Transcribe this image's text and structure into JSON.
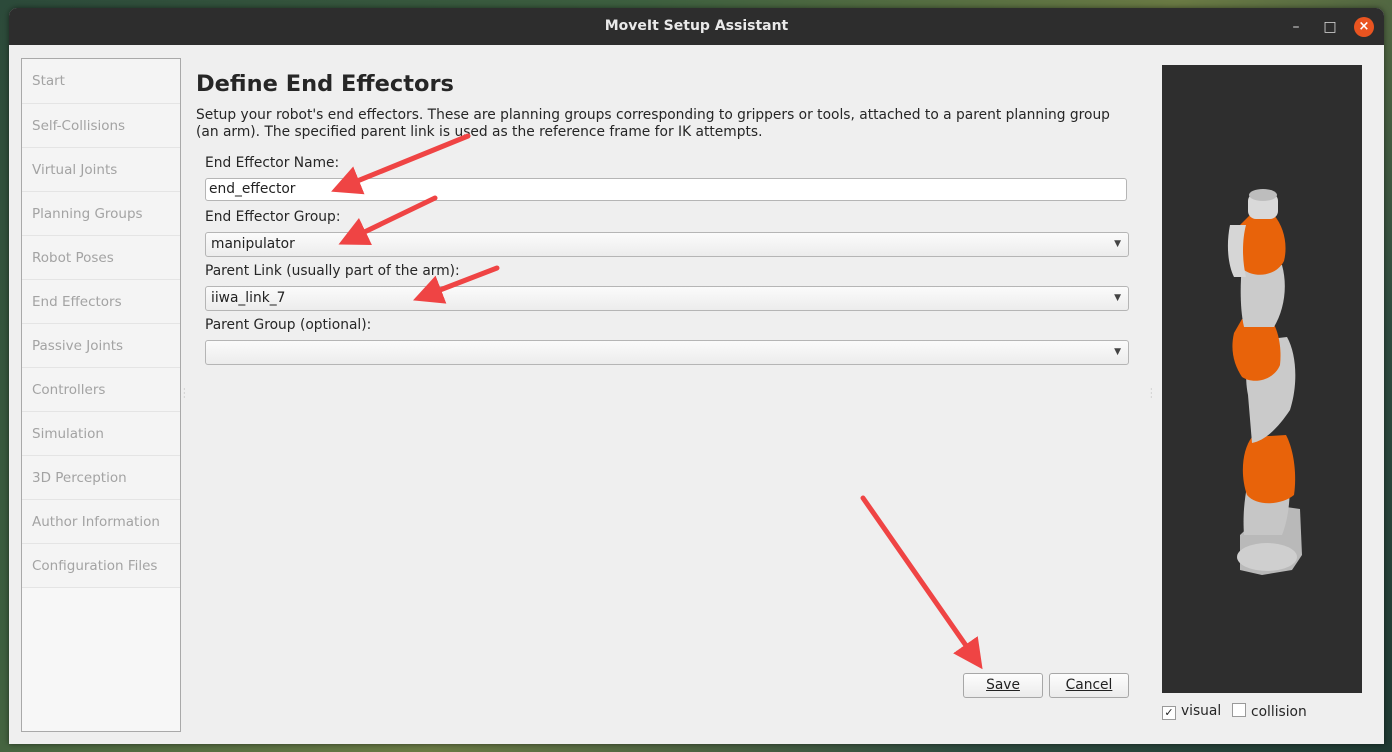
{
  "window": {
    "title": "MoveIt Setup Assistant"
  },
  "window_controls": {
    "minimize": "–",
    "maximize": "□",
    "close": "×"
  },
  "sidebar": {
    "items": [
      {
        "label": "Start"
      },
      {
        "label": "Self-Collisions"
      },
      {
        "label": "Virtual Joints"
      },
      {
        "label": "Planning Groups"
      },
      {
        "label": "Robot Poses"
      },
      {
        "label": "End Effectors"
      },
      {
        "label": "Passive Joints"
      },
      {
        "label": "Controllers"
      },
      {
        "label": "Simulation"
      },
      {
        "label": "3D Perception"
      },
      {
        "label": "Author Information"
      },
      {
        "label": "Configuration Files"
      }
    ]
  },
  "main": {
    "title": "Define End Effectors",
    "description": "Setup your robot's end effectors. These are planning groups corresponding to grippers or tools, attached to a parent planning group (an arm). The specified parent link is used as the reference frame for IK attempts.",
    "ee_name": {
      "label": "End Effector Name:",
      "value": "end_effector"
    },
    "ee_group": {
      "label": "End Effector Group:",
      "value": "manipulator"
    },
    "parent_link": {
      "label": "Parent Link (usually part of the arm):",
      "value": "iiwa_link_7"
    },
    "parent_group": {
      "label": "Parent Group (optional):",
      "value": ""
    },
    "save_label": "Save",
    "cancel_label": "Cancel"
  },
  "viewer": {
    "visual_label": "visual",
    "visual_checked": true,
    "collision_label": "collision",
    "collision_checked": false,
    "robot_colors": {
      "orange": "#e8630a",
      "grey": "#c9c9c9",
      "background": "#2e2e2e"
    }
  },
  "annotation_color": "#ef4444"
}
